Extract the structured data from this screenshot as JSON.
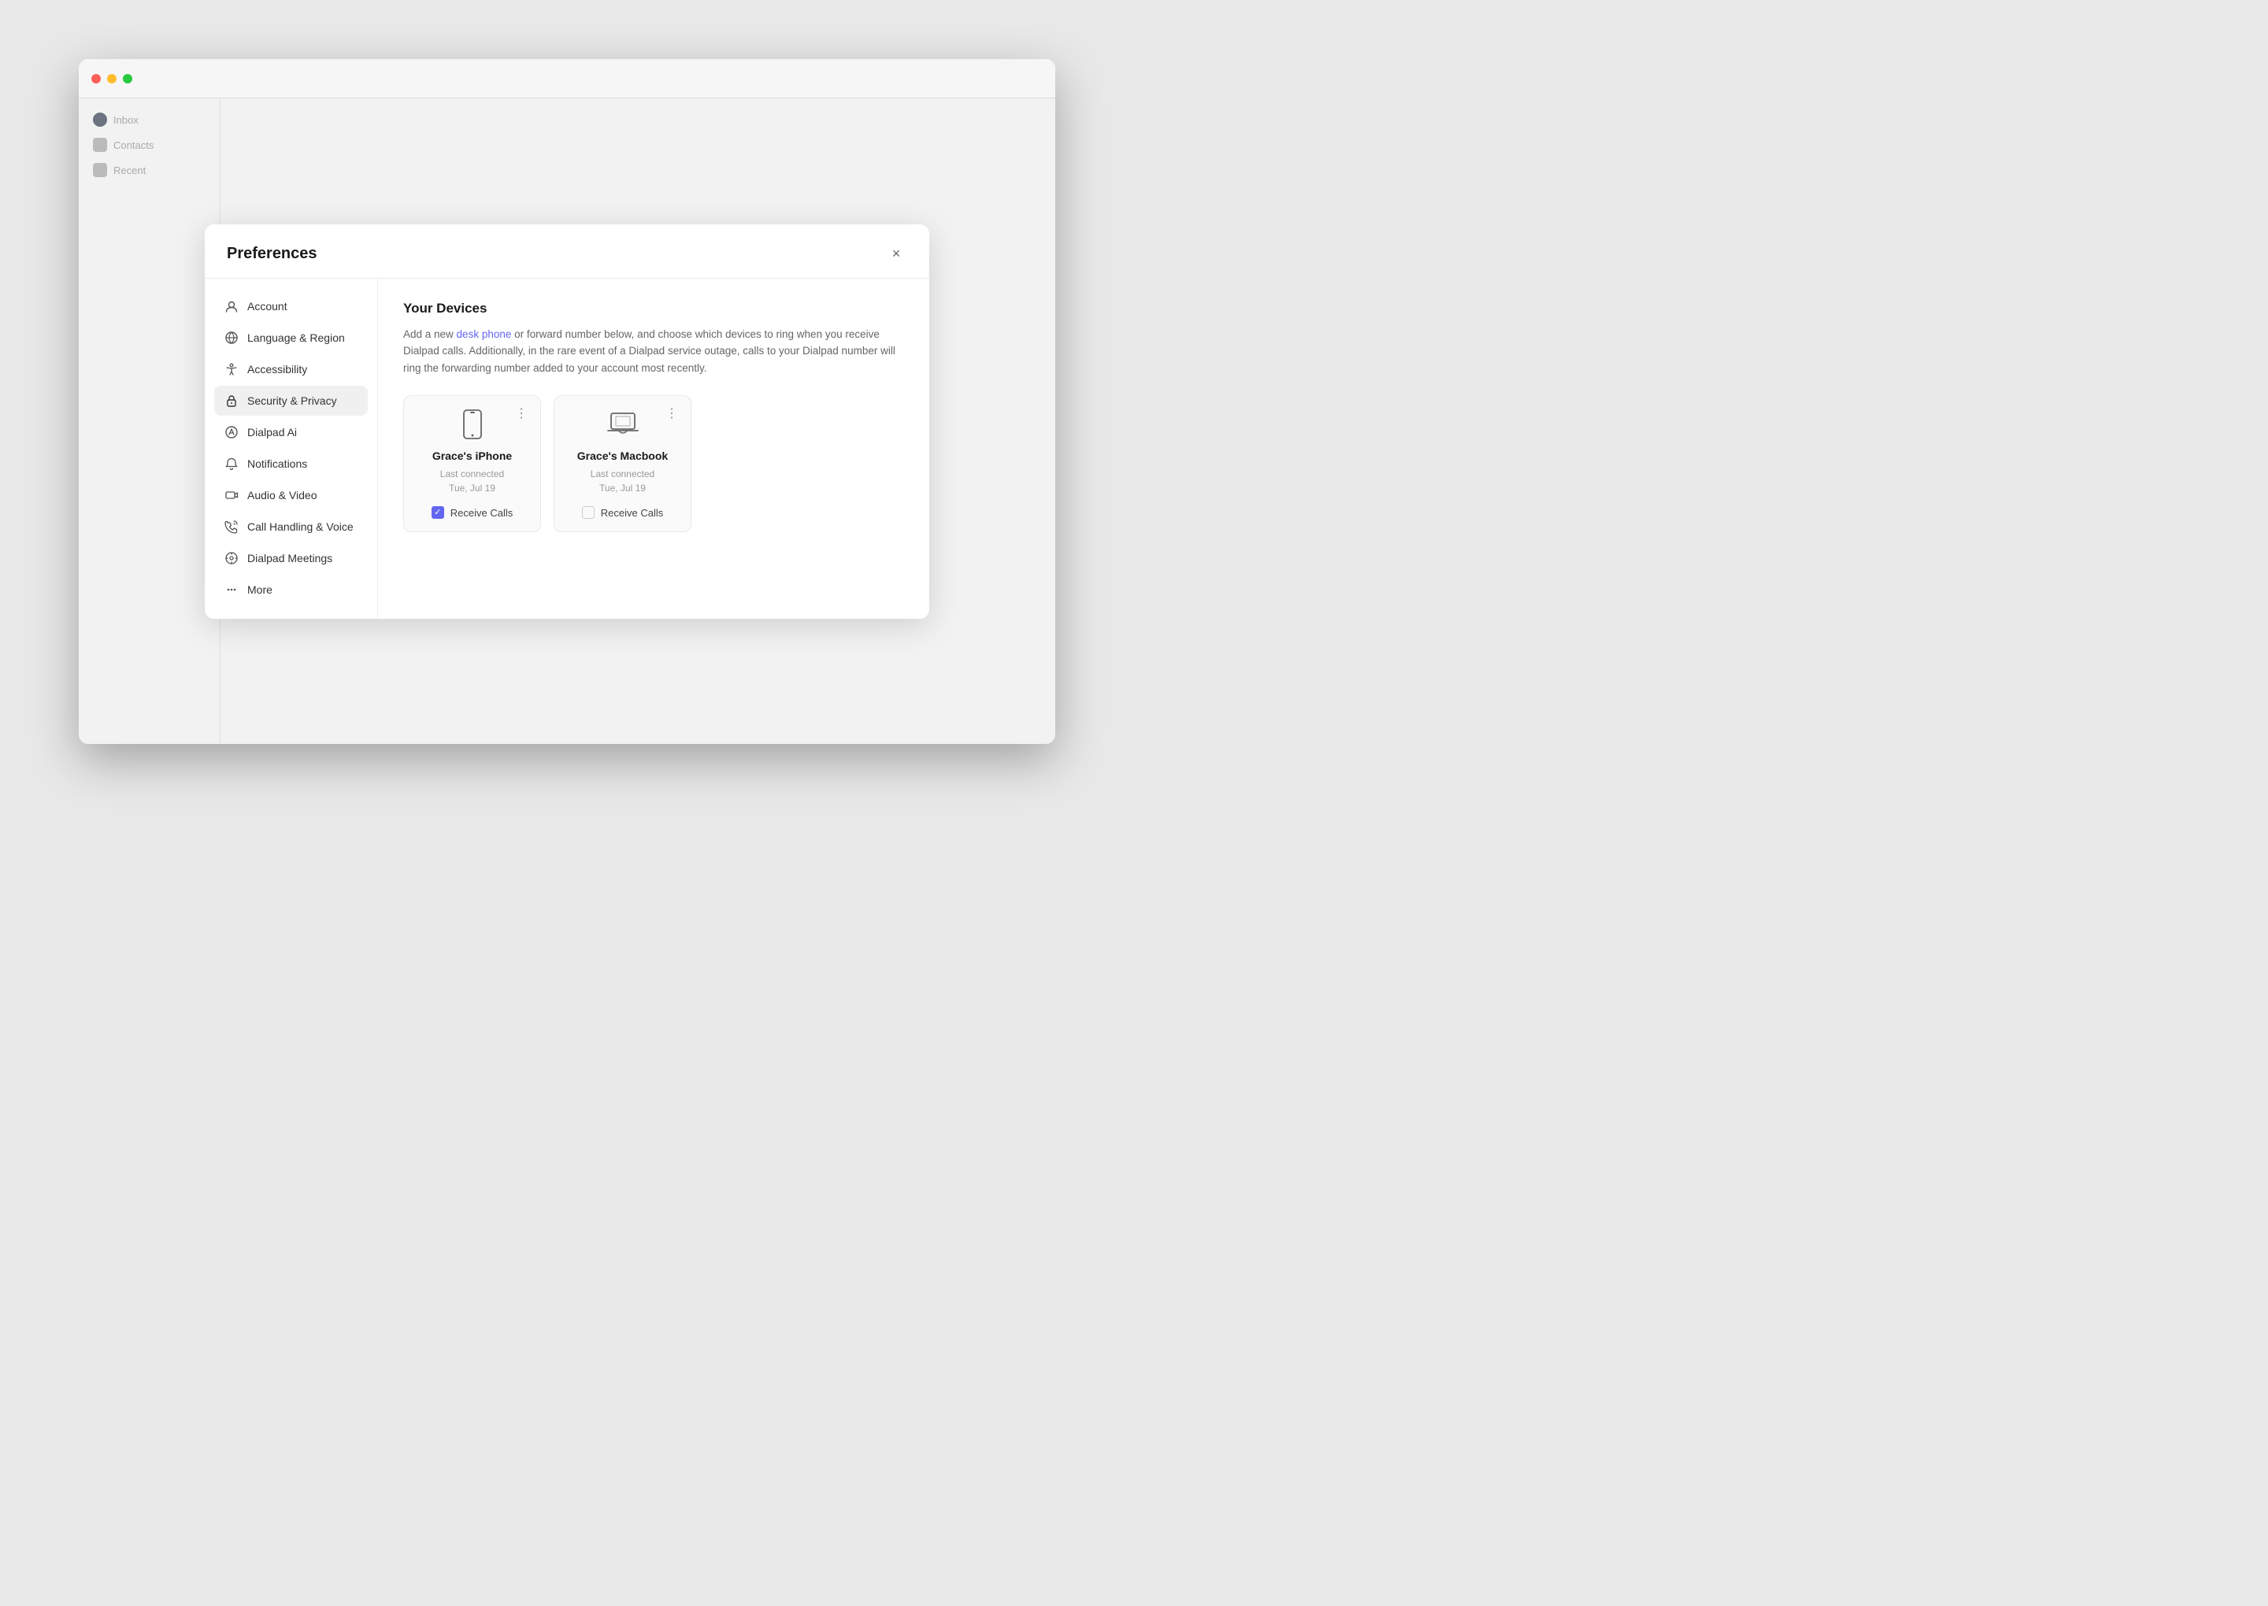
{
  "modal": {
    "title": "Preferences",
    "close_label": "×"
  },
  "nav": {
    "items": [
      {
        "id": "account",
        "label": "Account",
        "icon": "avatar"
      },
      {
        "id": "language",
        "label": "Language & Region",
        "icon": "language"
      },
      {
        "id": "accessibility",
        "label": "Accessibility",
        "icon": "accessibility"
      },
      {
        "id": "security",
        "label": "Security & Privacy",
        "icon": "lock",
        "active": true
      },
      {
        "id": "dialpad-ai",
        "label": "Dialpad Ai",
        "icon": "ai"
      },
      {
        "id": "notifications",
        "label": "Notifications",
        "icon": "bell"
      },
      {
        "id": "audio-video",
        "label": "Audio & Video",
        "icon": "camera"
      },
      {
        "id": "call-handling",
        "label": "Call Handling & Voice",
        "icon": "phone"
      },
      {
        "id": "dialpad-meetings",
        "label": "Dialpad Meetings",
        "icon": "meetings"
      },
      {
        "id": "more",
        "label": "More",
        "icon": "more"
      }
    ]
  },
  "content": {
    "title": "Your Devices",
    "description_before": "Add a new ",
    "description_link": "desk phone",
    "description_after": " or forward number below, and choose which devices to ring when you receive Dialpad calls. Additionally, in the rare event of a Dialpad service outage, calls to your Dialpad number will ring the forwarding number added to your account most recently.",
    "devices": [
      {
        "name": "Grace's iPhone",
        "connected_label": "Last connected",
        "connected_date": "Tue, Jul 19",
        "receive_calls": true,
        "receive_calls_label": "Receive Calls",
        "icon": "phone"
      },
      {
        "name": "Grace's Macbook",
        "connected_label": "Last connected",
        "connected_date": "Tue, Jul 19",
        "receive_calls": false,
        "receive_calls_label": "Receive Calls",
        "icon": "laptop"
      }
    ]
  }
}
